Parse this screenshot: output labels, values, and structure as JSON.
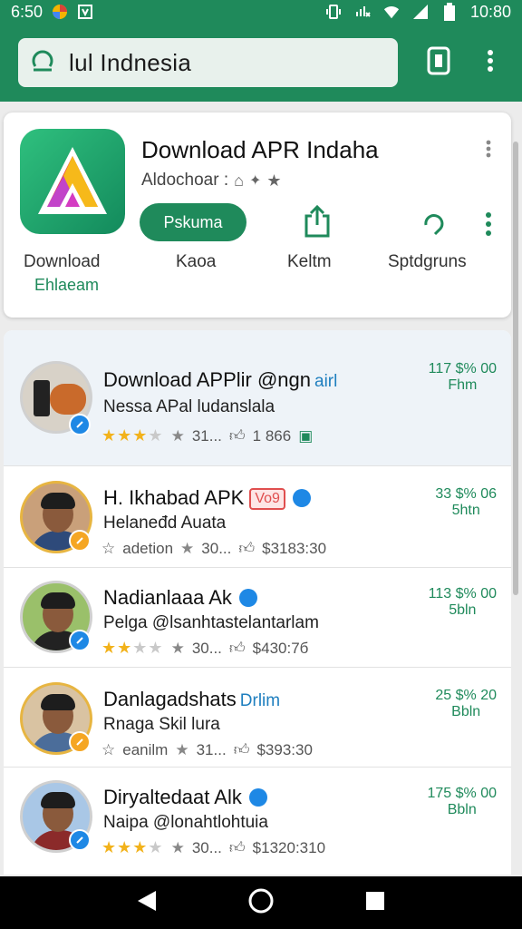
{
  "status_bar": {
    "time_left": "6:50",
    "time_right": "10:80"
  },
  "search": {
    "query": "lul Indnesia"
  },
  "featured": {
    "title": "Download APR Indaha",
    "subtitle": "Aldochoar :",
    "primary_button": "Pskuma",
    "actions": [
      {
        "label": "Download",
        "icon": "download-icon"
      },
      {
        "label": "Kaoa",
        "icon": "play-icon"
      },
      {
        "label": "Keltm",
        "icon": "share-icon"
      },
      {
        "label": "Sptdgruns",
        "icon": "rate-icon"
      }
    ],
    "download_sub": "Ehlaeam"
  },
  "rows": [
    {
      "title": "Download APPlir @ngn",
      "accent": "airl",
      "tag": "",
      "verified": false,
      "subtitle": "Nessa APal ludanslala",
      "rating": 3,
      "meta_a": "31...",
      "meta_b": "1 866",
      "price_1": "117 $% 00",
      "price_2": "Fhm"
    },
    {
      "title": "H. Ikhabad APK",
      "accent": "",
      "tag": "Vo9",
      "verified": true,
      "subtitle": "Helaneđd Auata",
      "rating": 0,
      "rating_text": "adetion",
      "meta_a": "30...",
      "meta_b": "$3183:30",
      "price_1": "33 $% 06",
      "price_2": "5htn"
    },
    {
      "title": "Nadianlaaa Ak",
      "accent": "",
      "tag": "",
      "verified": true,
      "subtitle": "Pelga @lsanhtastelantarlam",
      "rating": 2,
      "meta_a": "30...",
      "meta_b": "$430:7б",
      "price_1": "113 $% 00",
      "price_2": "5bln"
    },
    {
      "title": "Danlagadshats",
      "accent": "Drlim",
      "tag": "",
      "verified": false,
      "subtitle": "Rnaga Skil lura",
      "rating": 0,
      "rating_text": "eanilm",
      "meta_a": "31...",
      "meta_b": "$393:30",
      "price_1": "25 $% 20",
      "price_2": "Bbln"
    },
    {
      "title": "Diryaltedaat Alk",
      "accent": "",
      "tag": "",
      "verified": true,
      "subtitle": "Naipa @lonahtlohtuia",
      "rating": 3,
      "meta_a": "30...",
      "meta_b": "$1320:310",
      "price_1": "175 $% 00",
      "price_2": "Bbln"
    }
  ]
}
